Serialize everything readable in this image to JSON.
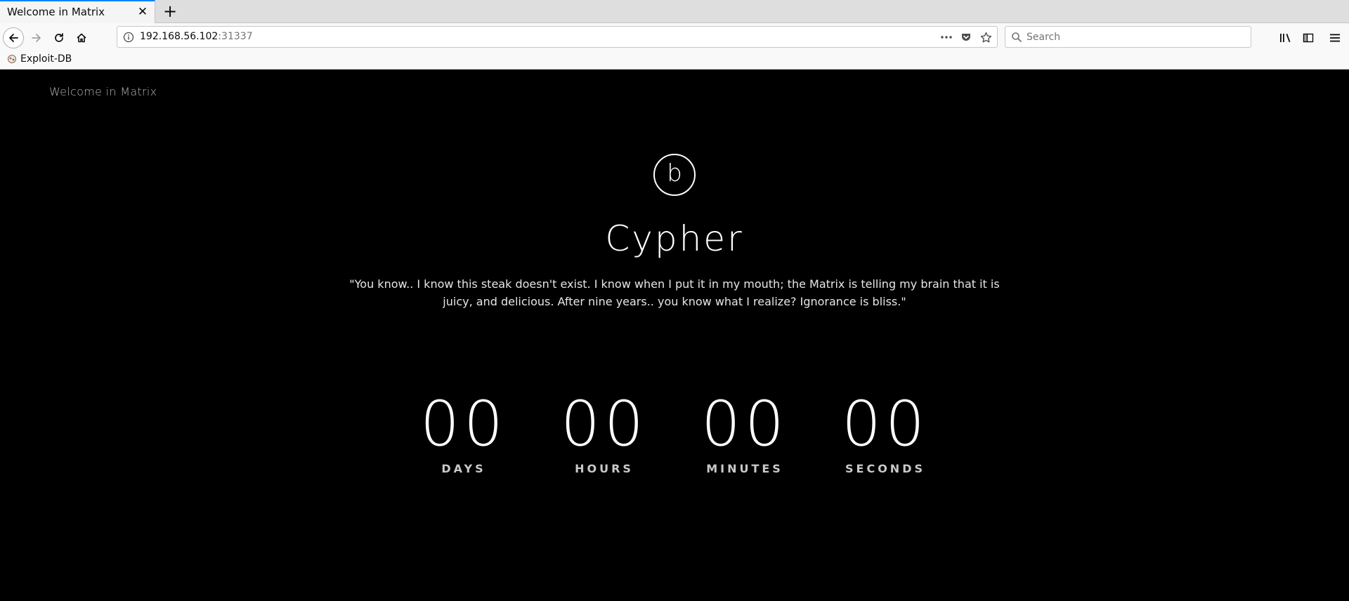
{
  "browser": {
    "tab": {
      "title": "Welcome in Matrix"
    },
    "url": {
      "host": "192.168.56.102",
      "port": ":31337"
    },
    "search": {
      "placeholder": "Search"
    },
    "bookmarks": [
      {
        "label": "Exploit-DB"
      }
    ]
  },
  "page": {
    "brand": "Welcome in Matrix",
    "logo_letter": "b",
    "title": "Cypher",
    "quote": "\"You know.. I know this steak doesn't exist. I know when I put it in my mouth; the Matrix is telling my brain that it is juicy, and delicious. After nine years.. you know what I realize? Ignorance is bliss.\"",
    "countdown": [
      {
        "value": "00",
        "label": "DAYS"
      },
      {
        "value": "00",
        "label": "HOURS"
      },
      {
        "value": "00",
        "label": "MINUTES"
      },
      {
        "value": "00",
        "label": "SECONDS"
      }
    ]
  },
  "colors": {
    "page_background": "#000000",
    "tab_accent": "#0a84ff",
    "text_primary": "#ffffff"
  }
}
